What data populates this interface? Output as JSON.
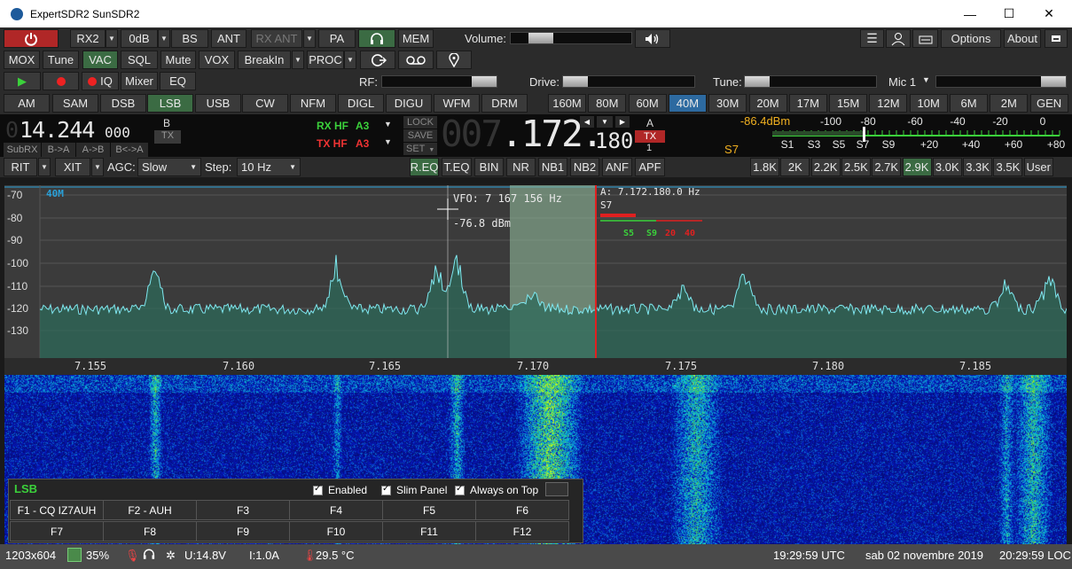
{
  "window": {
    "title": "ExpertSDR2 SunSDR2",
    "min": "—",
    "max": "☐",
    "close": "✕"
  },
  "row1": {
    "rx2": "RX2",
    "gain": "0dB",
    "bs": "BS",
    "ant": "ANT",
    "rxant": "RX ANT",
    "pa": "PA",
    "mem": "MEM",
    "volume_label": "Volume:",
    "volume_level": 0.15,
    "options": "Options",
    "about": "About"
  },
  "row2": {
    "mox": "MOX",
    "tune": "Tune",
    "vac": "VAC",
    "sql": "SQL",
    "mute": "Mute",
    "vox": "VOX",
    "breakin": "BreakIn",
    "proc": "PROC"
  },
  "row3": {
    "iq": "IQ",
    "mixer": "Mixer",
    "eq": "EQ",
    "rf_label": "RF:",
    "drive_label": "Drive:",
    "tune_label": "Tune:",
    "mic": "Mic 1"
  },
  "modes": [
    "AM",
    "SAM",
    "DSB",
    "LSB",
    "USB",
    "CW",
    "NFM",
    "DIGL",
    "DIGU",
    "WFM",
    "DRM"
  ],
  "active_mode": "LSB",
  "bands": [
    "160M",
    "80M",
    "60M",
    "40M",
    "30M",
    "20M",
    "17M",
    "15M",
    "12M",
    "10M",
    "6M",
    "2M",
    "GEN"
  ],
  "active_band": "40M",
  "freq": {
    "vfo_b_big": "14.244",
    "vfo_b_small": "000",
    "vfo_b_prefix": "0",
    "b_label": "B",
    "tx_label": "TX",
    "subrx": "SubRX",
    "btoa": "B->A",
    "atob": "A->B",
    "bswap": "B<->A",
    "rx_hf": "RX HF",
    "rx_ant": "A3",
    "tx_hf": "TX HF",
    "tx_ant": "A3",
    "lock": "LOCK",
    "save": "SAVE",
    "set": "SET",
    "vfo_a_big": "007.172.",
    "vfo_a_small": "180",
    "a_label": "A",
    "a_tx": "TX",
    "a_num": "1"
  },
  "smeter": {
    "dbm": "-86.4dBm",
    "s_value": "S7",
    "scale_top": [
      "-100",
      "-80",
      "-60",
      "-40",
      "-20",
      "0"
    ],
    "scale_bottom": [
      "S1",
      "S3",
      "S5",
      "S7",
      "S9",
      "+20",
      "+40",
      "+60",
      "+80"
    ]
  },
  "row5": {
    "rit": "RIT",
    "xit": "XIT",
    "agc_label": "AGC:",
    "agc_value": "Slow",
    "step_label": "Step:",
    "step_value": "10 Hz",
    "dsp": [
      "R.EQ",
      "T.EQ",
      "BIN",
      "NR",
      "NB1",
      "NB2",
      "ANF",
      "APF"
    ],
    "filters": [
      "1.8K",
      "2K",
      "2.2K",
      "2.5K",
      "2.7K",
      "2.9K",
      "3.0K",
      "3.3K",
      "3.5K",
      "User"
    ],
    "active_filter": "2.9K"
  },
  "spectrum": {
    "band_label": "40M",
    "db_ticks": [
      "-70",
      "-80",
      "-90",
      "-100",
      "-110",
      "-120",
      "-130"
    ],
    "freq_ticks": [
      "7.155",
      "7.160",
      "7.165",
      "7.170",
      "7.175",
      "7.180",
      "7.185"
    ],
    "cursor_vfo": "VFO: 7 167 156 Hz",
    "cursor_dbm": "-76.8 dBm",
    "a_freq": "A: 7.172.180.0 Hz",
    "a_s": "S7",
    "mini_scale": [
      "S5",
      "S9",
      "20",
      "40"
    ]
  },
  "fpanel": {
    "mode": "LSB",
    "enabled": "Enabled",
    "slim": "Slim Panel",
    "ontop": "Always on Top",
    "keys": [
      "F1 - CQ IZ7AUH",
      "F2 - AUH",
      "F3",
      "F4",
      "F5",
      "F6",
      "F7",
      "F8",
      "F9",
      "F10",
      "F11",
      "F12"
    ]
  },
  "status": {
    "res": "1203x604",
    "cpu": "35%",
    "voltage": "U:14.8V",
    "current": "I:1.0A",
    "temp": "29.5 °C",
    "utc": "19:29:59 UTC",
    "date": "sab 02 novembre 2019",
    "loc": "20:29:59 LOC"
  },
  "colors": {
    "accent_green": "#3b6b43",
    "accent_blue": "#2d6aa0",
    "power_red": "#b02727",
    "trace": "#7fe8f0"
  }
}
